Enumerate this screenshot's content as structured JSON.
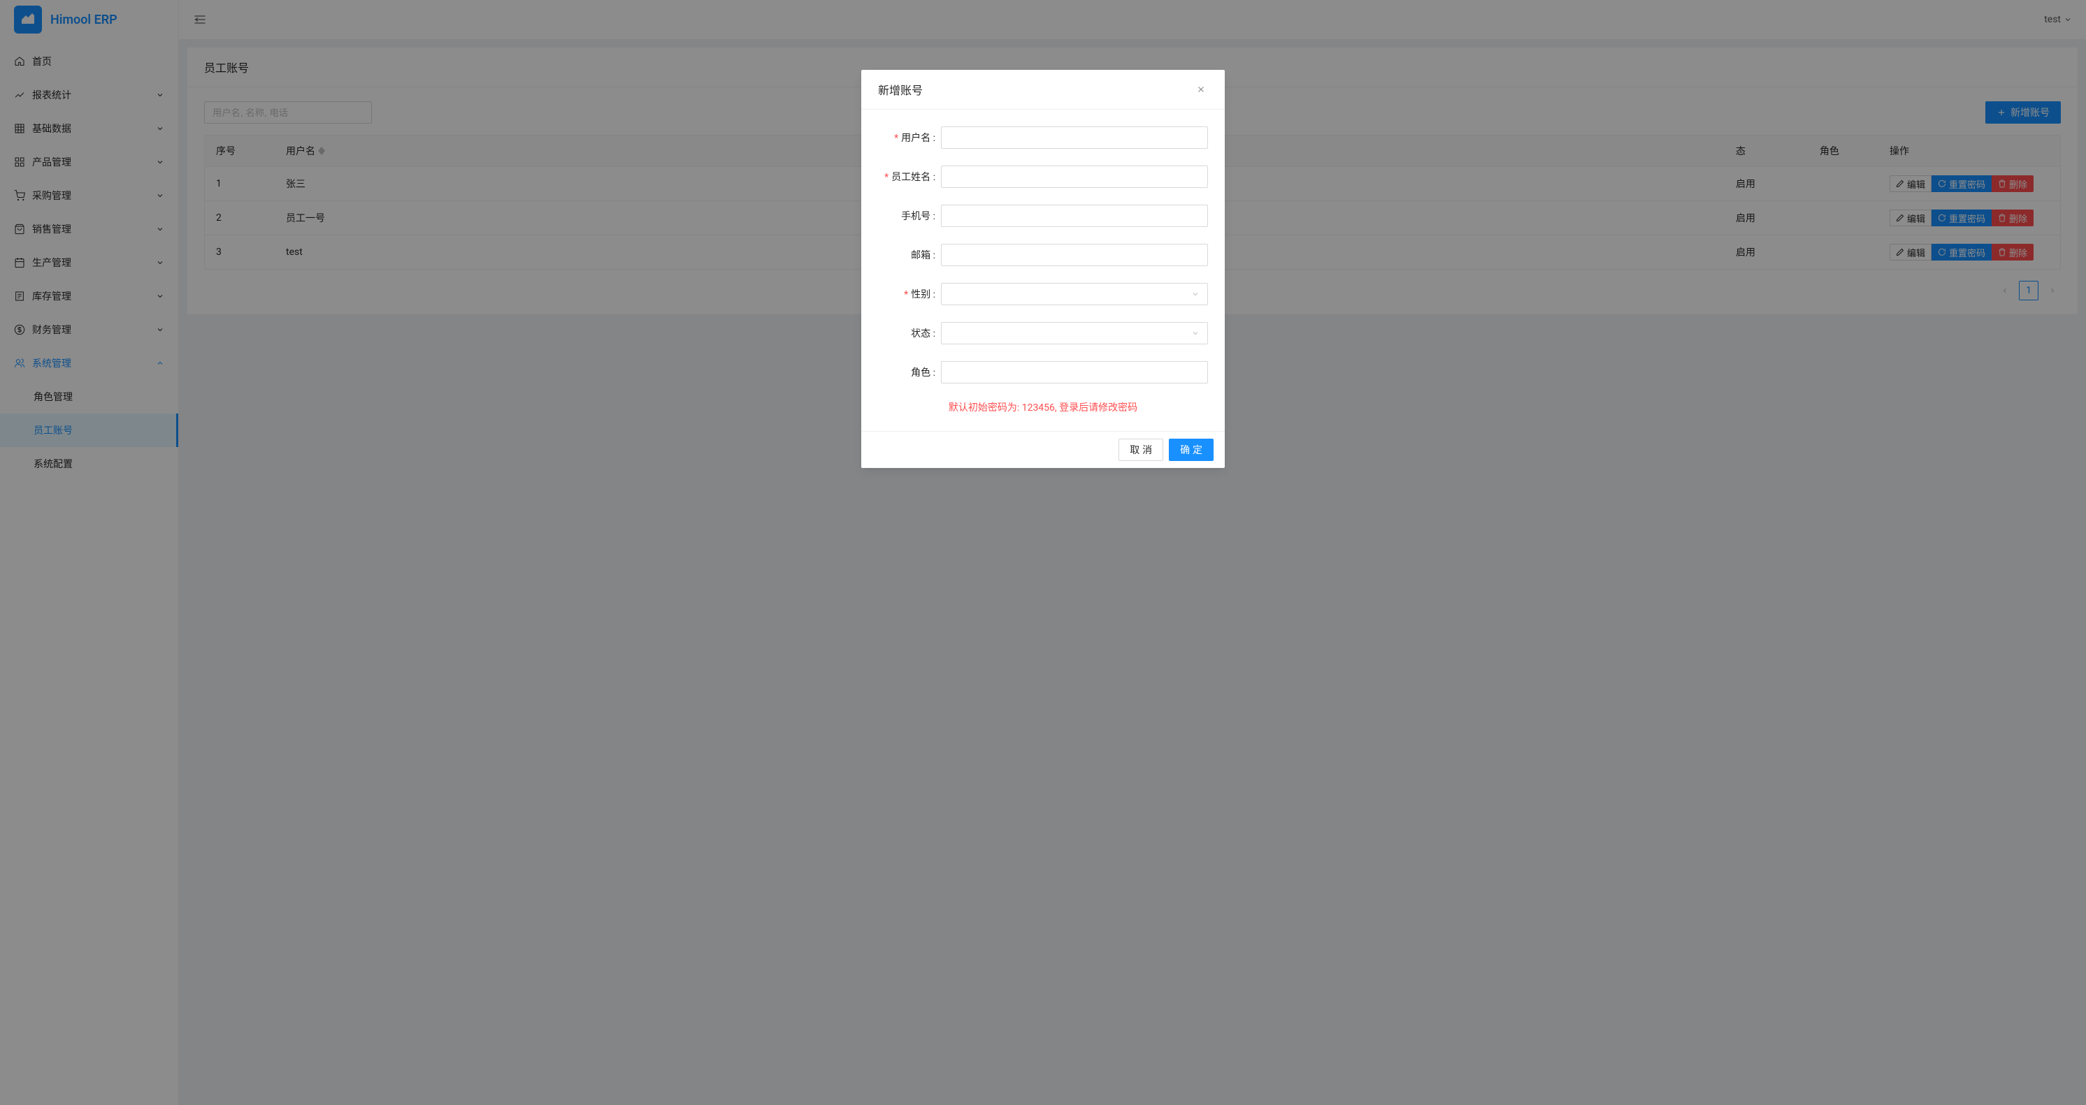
{
  "app": {
    "name": "Himool ERP"
  },
  "sidebar": {
    "items": [
      {
        "label": "首页",
        "icon": "home"
      },
      {
        "label": "报表统计",
        "icon": "chart",
        "hasChildren": true
      },
      {
        "label": "基础数据",
        "icon": "grid",
        "hasChildren": true
      },
      {
        "label": "产品管理",
        "icon": "apps",
        "hasChildren": true
      },
      {
        "label": "采购管理",
        "icon": "cart",
        "hasChildren": true
      },
      {
        "label": "销售管理",
        "icon": "bag",
        "hasChildren": true
      },
      {
        "label": "生产管理",
        "icon": "calendar",
        "hasChildren": true
      },
      {
        "label": "库存管理",
        "icon": "list",
        "hasChildren": true
      },
      {
        "label": "财务管理",
        "icon": "dollar",
        "hasChildren": true
      },
      {
        "label": "系统管理",
        "icon": "users",
        "hasChildren": true,
        "expanded": true,
        "active": true
      }
    ],
    "subItems": [
      {
        "label": "角色管理"
      },
      {
        "label": "员工账号",
        "active": true
      },
      {
        "label": "系统配置"
      }
    ]
  },
  "header": {
    "username": "test"
  },
  "page": {
    "title": "员工账号",
    "searchPlaceholder": "用户名, 名称, 电话",
    "addButton": "新增账号"
  },
  "table": {
    "columns": {
      "seq": "序号",
      "username": "用户名",
      "status": "态",
      "role": "角色",
      "action": "操作"
    },
    "rows": [
      {
        "seq": "1",
        "username": "张三",
        "status": "启用"
      },
      {
        "seq": "2",
        "username": "员工一号",
        "status": "启用"
      },
      {
        "seq": "3",
        "username": "test",
        "status": "启用"
      }
    ],
    "actions": {
      "edit": "编辑",
      "reset": "重置密码",
      "delete": "删除"
    }
  },
  "pagination": {
    "current": "1"
  },
  "modal": {
    "title": "新增账号",
    "fields": {
      "username": "用户名",
      "name": "员工姓名",
      "phone": "手机号",
      "email": "邮箱",
      "gender": "性别",
      "status": "状态",
      "role": "角色"
    },
    "hint": "默认初始密码为: 123456, 登录后请修改密码",
    "cancel": "取 消",
    "confirm": "确 定"
  }
}
